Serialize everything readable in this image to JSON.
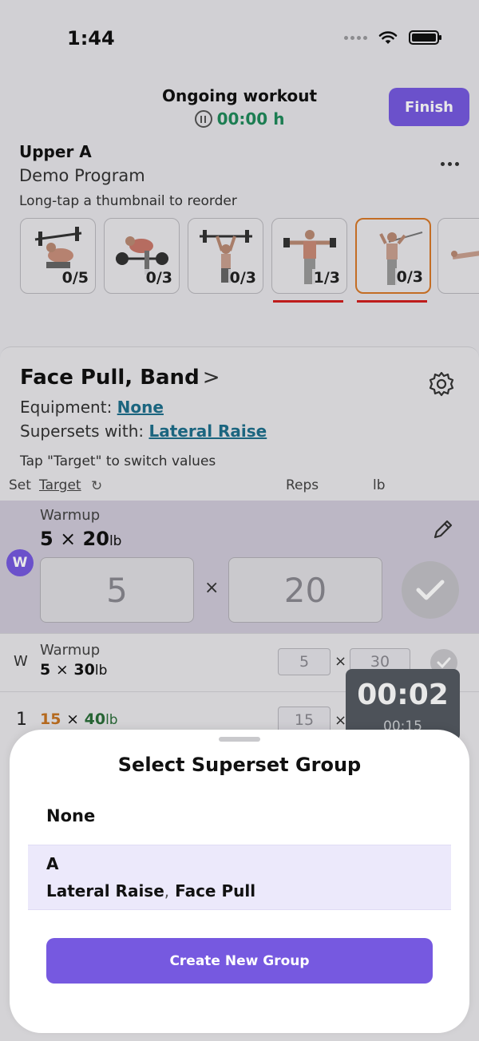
{
  "status_bar": {
    "time": "1:44",
    "icons": [
      "signal-icon",
      "wifi-icon",
      "battery-icon"
    ]
  },
  "header": {
    "title": "Ongoing workout",
    "timer": "00:00 h",
    "finish_label": "Finish"
  },
  "program": {
    "name": "Upper A",
    "subtitle": "Demo Program",
    "reorder_hint": "Long-tap a thumbnail to reorder"
  },
  "thumbnails": [
    {
      "count": "0/5",
      "superset": false,
      "active": false
    },
    {
      "count": "0/3",
      "superset": false,
      "active": false
    },
    {
      "count": "0/3",
      "superset": false,
      "active": false
    },
    {
      "count": "1/3",
      "superset": true,
      "active": false
    },
    {
      "count": "0/3",
      "superset": true,
      "active": true
    }
  ],
  "exercise": {
    "name": "Face Pull, Band",
    "chevron": ">",
    "equipment_label": "Equipment:",
    "equipment_value": "None",
    "superset_label": "Supersets with:",
    "superset_value": "Lateral Raise",
    "tap_hint": "Tap \"Target\" to switch values",
    "columns": {
      "set": "Set",
      "target": "Target",
      "reps": "Reps",
      "lb": "lb"
    }
  },
  "active_set": {
    "badge": "W",
    "label": "Warmup",
    "reps": "5",
    "times": "×",
    "weight": "20",
    "unit": "lb",
    "reps_input": "5",
    "weight_input": "20"
  },
  "set_rows": [
    {
      "set": "W",
      "label": "Warmup",
      "reps": "5",
      "times": "×",
      "weight": "30",
      "unit": "lb",
      "reps_input": "5",
      "weight_input": "30"
    },
    {
      "set": "1",
      "reps": "15",
      "times": "×",
      "weight": "40",
      "unit": "lb",
      "reps_input": "15"
    }
  ],
  "rest_timer": {
    "elapsed": "00:02",
    "target": "00:15"
  },
  "sheet": {
    "title": "Select Superset Group",
    "option_none": "None",
    "option_a_title": "A",
    "option_a_member1": "Lateral Raise",
    "option_a_separator": ",",
    "option_a_member2": "Face Pull",
    "create_label": "Create New Group"
  },
  "colors": {
    "accent": "#7659e0",
    "timer_green": "#1f8a5b",
    "active_thumb_border": "#d77828",
    "superset_underline": "#d11f1f",
    "link": "#1e6f8c",
    "selected_option_bg": "#ece9fb"
  }
}
